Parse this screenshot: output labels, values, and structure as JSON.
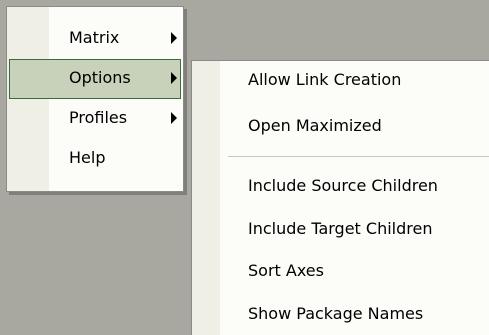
{
  "main_menu": {
    "items": [
      {
        "label": "Matrix",
        "has_submenu": true,
        "highlighted": false
      },
      {
        "label": "Options",
        "has_submenu": true,
        "highlighted": true
      },
      {
        "label": "Profiles",
        "has_submenu": true,
        "highlighted": false
      },
      {
        "label": "Help",
        "has_submenu": false,
        "highlighted": false
      }
    ],
    "highlight_color": "#c8d1b9",
    "highlight_border_color": "#3c6a3c"
  },
  "options_submenu": {
    "groups": [
      {
        "items": [
          {
            "label": "Allow Link Creation"
          },
          {
            "label": "Open Maximized"
          }
        ]
      },
      {
        "items": [
          {
            "label": "Include Source Children"
          },
          {
            "label": "Include Target Children"
          },
          {
            "label": "Sort Axes"
          },
          {
            "label": "Show Package Names"
          }
        ]
      }
    ]
  },
  "colors": {
    "menu_background": "#fcfcf9",
    "gutter": "#f0efe6",
    "app_background": "#a8a7a0"
  }
}
